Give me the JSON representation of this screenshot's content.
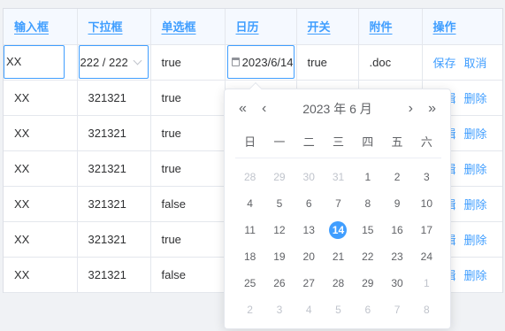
{
  "headers": [
    "输入框",
    "下拉框",
    "单选框",
    "日历",
    "开关",
    "附件",
    "操作"
  ],
  "edit_row": {
    "input": "XX",
    "select": "222 / 222",
    "radio": "true",
    "date": "2023/6/14",
    "switch": "true",
    "file": ".doc",
    "save": "保存",
    "cancel": "取消"
  },
  "rows": [
    {
      "input": "XX",
      "select": "321321",
      "radio": "true",
      "edit": "编辑",
      "delete": "删除"
    },
    {
      "input": "XX",
      "select": "321321",
      "radio": "true",
      "edit": "编辑",
      "delete": "删除"
    },
    {
      "input": "XX",
      "select": "321321",
      "radio": "true",
      "edit": "编辑",
      "delete": "删除"
    },
    {
      "input": "XX",
      "select": "321321",
      "radio": "false",
      "edit": "编辑",
      "delete": "删除"
    },
    {
      "input": "XX",
      "select": "321321",
      "radio": "true",
      "edit": "编辑",
      "delete": "删除"
    },
    {
      "input": "XX",
      "select": "321321",
      "radio": "false",
      "edit": "编辑",
      "delete": "删除"
    }
  ],
  "calendar": {
    "title": "2023 年  6 月",
    "prev_year": "«",
    "prev_month": "‹",
    "next_month": "›",
    "next_year": "»",
    "weekdays": [
      "日",
      "一",
      "二",
      "三",
      "四",
      "五",
      "六"
    ],
    "weeks": [
      [
        [
          "28",
          1
        ],
        [
          "29",
          1
        ],
        [
          "30",
          1
        ],
        [
          "31",
          1
        ],
        [
          "1",
          0
        ],
        [
          "2",
          0
        ],
        [
          "3",
          0
        ]
      ],
      [
        [
          "4",
          0
        ],
        [
          "5",
          0
        ],
        [
          "6",
          0
        ],
        [
          "7",
          0
        ],
        [
          "8",
          0
        ],
        [
          "9",
          0
        ],
        [
          "10",
          0
        ]
      ],
      [
        [
          "11",
          0
        ],
        [
          "12",
          0
        ],
        [
          "13",
          0
        ],
        [
          "14",
          2
        ],
        [
          "15",
          0
        ],
        [
          "16",
          0
        ],
        [
          "17",
          0
        ]
      ],
      [
        [
          "18",
          0
        ],
        [
          "19",
          0
        ],
        [
          "20",
          0
        ],
        [
          "21",
          0
        ],
        [
          "22",
          0
        ],
        [
          "23",
          0
        ],
        [
          "24",
          0
        ]
      ],
      [
        [
          "25",
          0
        ],
        [
          "26",
          0
        ],
        [
          "27",
          0
        ],
        [
          "28",
          0
        ],
        [
          "29",
          0
        ],
        [
          "30",
          0
        ],
        [
          "1",
          1
        ]
      ],
      [
        [
          "2",
          1
        ],
        [
          "3",
          1
        ],
        [
          "4",
          1
        ],
        [
          "5",
          1
        ],
        [
          "6",
          1
        ],
        [
          "7",
          1
        ],
        [
          "8",
          1
        ]
      ]
    ]
  }
}
